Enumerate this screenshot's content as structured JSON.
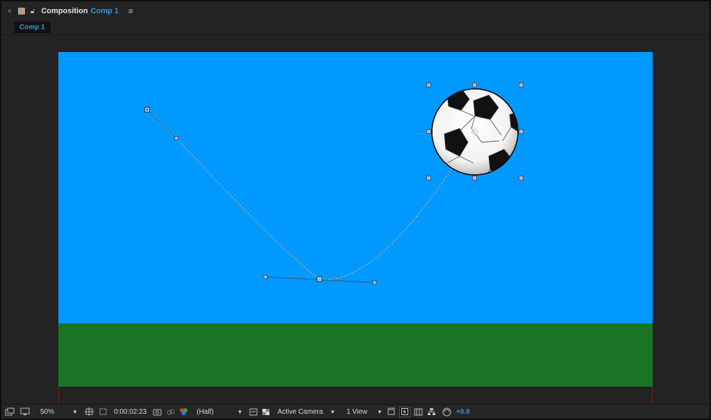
{
  "header": {
    "close_glyph": "×",
    "title": "Composition",
    "comp_name": "Comp 1",
    "menu_glyph": "≡",
    "swatch_color": "#b79c8c"
  },
  "tabs": [
    {
      "label": "Comp 1",
      "active": true
    }
  ],
  "colors": {
    "sky": "#0099ff",
    "ground": "#1a7425",
    "accent": "#2f9bd8",
    "panel": "#232323"
  },
  "toolbar": {
    "zoom": "50%",
    "timecode": "0:00:02:23",
    "resolution": "(Half)",
    "camera": "Active Camera",
    "views": "1 View",
    "exposure": "+0.0",
    "icons": [
      "always-preview-icon",
      "monitor-icon",
      "region-of-interest-icon",
      "transparency-grid-icon",
      "snapshot-icon",
      "show-snapshot-icon",
      "color-channels-icon",
      "fast-preview-icon",
      "flowchart-icon",
      "reset-exposure-icon"
    ]
  }
}
